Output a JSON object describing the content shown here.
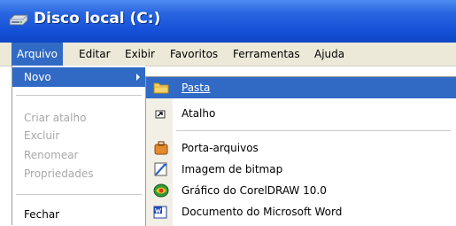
{
  "window": {
    "title": "Disco local (C:)"
  },
  "menubar": {
    "items": [
      "Arquivo",
      "Editar",
      "Exibir",
      "Favoritos",
      "Ferramentas",
      "Ajuda"
    ]
  },
  "file_menu": {
    "items": [
      {
        "label": "Novo",
        "state": "selected"
      },
      {
        "label": "Criar atalho",
        "state": "disabled"
      },
      {
        "label": "Excluir",
        "state": "disabled"
      },
      {
        "label": "Renomear",
        "state": "disabled"
      },
      {
        "label": "Propriedades",
        "state": "disabled"
      },
      {
        "label": "Fechar",
        "state": "enabled"
      }
    ]
  },
  "new_submenu": {
    "items": [
      {
        "label": "Pasta",
        "icon": "folder-icon",
        "state": "selected"
      },
      {
        "label": "Atalho",
        "icon": "shortcut-icon",
        "state": "enabled"
      },
      {
        "label": "Porta-arquivos",
        "icon": "briefcase-icon",
        "state": "enabled"
      },
      {
        "label": "Imagem de bitmap",
        "icon": "bitmap-icon",
        "state": "enabled"
      },
      {
        "label": "Gráfico do CorelDRAW 10.0",
        "icon": "coreldraw-icon",
        "state": "enabled"
      },
      {
        "label": "Documento do Microsoft Word",
        "icon": "word-document-icon",
        "state": "enabled"
      }
    ]
  },
  "colors": {
    "titlebar": "#1552d8",
    "selection": "#316ac5",
    "menubar": "#ece9d8",
    "disabled_text": "#a8a8a8"
  }
}
